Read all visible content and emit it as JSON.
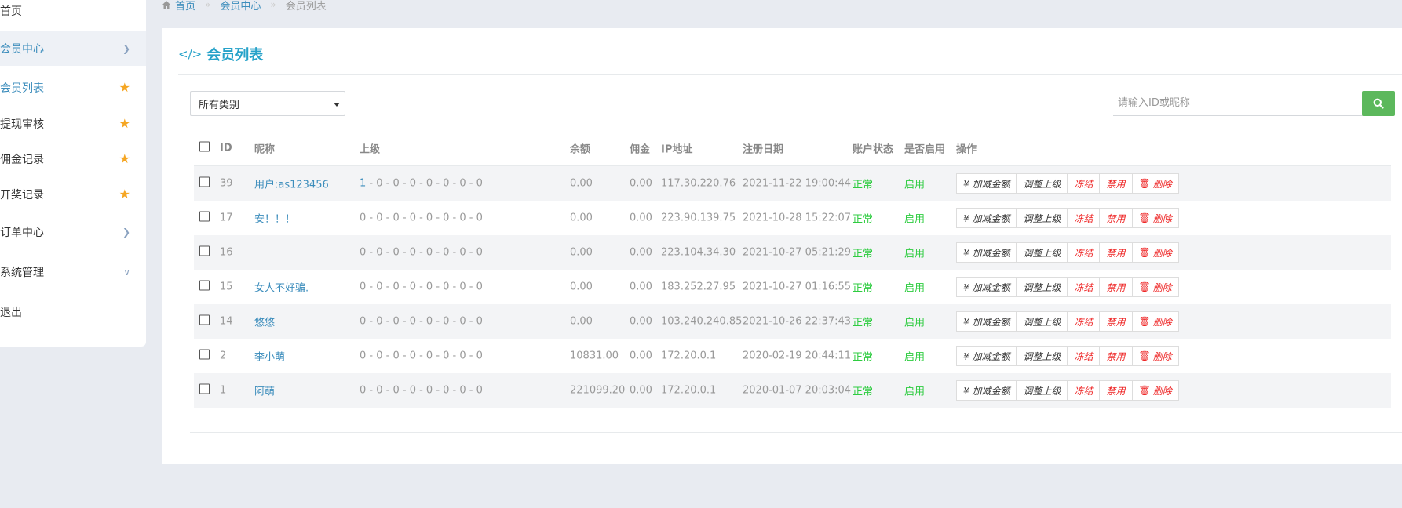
{
  "sidebar": {
    "items": [
      {
        "label": "首页"
      },
      {
        "label": "会员中心",
        "icon": "chevron-right"
      },
      {
        "label": "会员列表",
        "icon": "star"
      },
      {
        "label": "提现审核",
        "icon": "star"
      },
      {
        "label": "佣金记录",
        "icon": "star"
      },
      {
        "label": "开奖记录",
        "icon": "star"
      },
      {
        "label": "订单中心",
        "icon": "chevron-right"
      },
      {
        "label": "系统管理",
        "icon": "chevron-down"
      },
      {
        "label": "退出"
      }
    ]
  },
  "breadcrumb": {
    "home": "首页",
    "section": "会员中心",
    "current": "会员列表"
  },
  "panel": {
    "title": "会员列表"
  },
  "filter": {
    "category_selected": "所有类别",
    "search_placeholder": "请输入ID或昵称"
  },
  "table": {
    "headers": {
      "id": "ID",
      "nickname": "昵称",
      "parent": "上级",
      "balance": "余额",
      "commission": "佣金",
      "ip": "IP地址",
      "reg_date": "注册日期",
      "account_status": "账户状态",
      "enabled": "是否启用",
      "actions": "操作"
    },
    "actions": {
      "adjust_amount": "¥ 加减金额",
      "adjust_parent": "调整上级",
      "freeze": "冻结",
      "disable": "禁用",
      "delete": "删除"
    },
    "rows": [
      {
        "id": "39",
        "nickname": "用户:as123456",
        "parent_first": "1",
        "parent_rest": " - 0 - 0 - 0 - 0 - 0 - 0 - 0",
        "balance": "0.00",
        "commission": "0.00",
        "ip": "117.30.220.76",
        "reg_date": "2021-11-22 19:00:44",
        "status": "正常",
        "enabled": "启用"
      },
      {
        "id": "17",
        "nickname": "安！！！",
        "parent_first": "0",
        "parent_rest": " - 0 - 0 - 0 - 0 - 0 - 0 - 0",
        "balance": "0.00",
        "commission": "0.00",
        "ip": "223.90.139.75",
        "reg_date": "2021-10-28 15:22:07",
        "status": "正常",
        "enabled": "启用"
      },
      {
        "id": "16",
        "nickname": "",
        "parent_first": "0",
        "parent_rest": " - 0 - 0 - 0 - 0 - 0 - 0 - 0",
        "balance": "0.00",
        "commission": "0.00",
        "ip": "223.104.34.30",
        "reg_date": "2021-10-27 05:21:29",
        "status": "正常",
        "enabled": "启用"
      },
      {
        "id": "15",
        "nickname": "女人不好骗.",
        "parent_first": "0",
        "parent_rest": " - 0 - 0 - 0 - 0 - 0 - 0 - 0",
        "balance": "0.00",
        "commission": "0.00",
        "ip": "183.252.27.95",
        "reg_date": "2021-10-27 01:16:55",
        "status": "正常",
        "enabled": "启用"
      },
      {
        "id": "14",
        "nickname": "悠悠",
        "parent_first": "0",
        "parent_rest": " - 0 - 0 - 0 - 0 - 0 - 0 - 0",
        "balance": "0.00",
        "commission": "0.00",
        "ip": "103.240.240.85",
        "reg_date": "2021-10-26 22:37:43",
        "status": "正常",
        "enabled": "启用"
      },
      {
        "id": "2",
        "nickname": "李小萌",
        "parent_first": "0",
        "parent_rest": " - 0 - 0 - 0 - 0 - 0 - 0 - 0",
        "balance": "10831.00",
        "commission": "0.00",
        "ip": "172.20.0.1",
        "reg_date": "2020-02-19 20:44:11",
        "status": "正常",
        "enabled": "启用"
      },
      {
        "id": "1",
        "nickname": "阿萌",
        "parent_first": "0",
        "parent_rest": " - 0 - 0 - 0 - 0 - 0 - 0 - 0",
        "balance": "221099.20",
        "commission": "0.00",
        "ip": "172.20.0.1",
        "reg_date": "2020-01-07 20:03:04",
        "status": "正常",
        "enabled": "启用"
      }
    ]
  },
  "colors": {
    "accent": "#3c8dbc",
    "title": "#26a2c9",
    "success": "#2ecc40",
    "danger": "#e22222",
    "search_button": "#5cb85c",
    "star": "#f5a623"
  }
}
